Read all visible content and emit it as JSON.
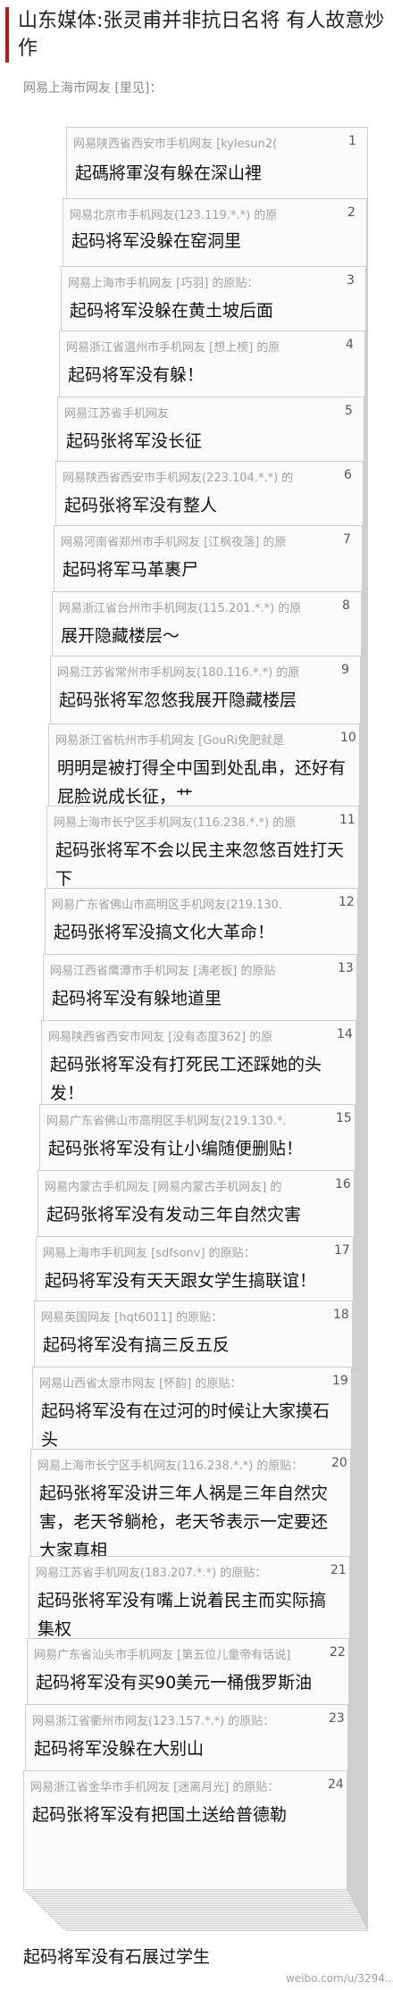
{
  "title": "山东媒体:张灵甫并非抗日名将 有人故意炒作",
  "outer_source": "网易上海市网友 [里见]：",
  "comments": [
    {
      "head": "网易陕西省西安市手机网友 [kylesun2(",
      "num": "1",
      "body": "起碼將軍沒有躲在深山裡"
    },
    {
      "head": "网易北京市手机网友(123.119.*.*) 的原",
      "num": "2",
      "body": "起码将军没躲在窑洞里"
    },
    {
      "head": "网易上海市手机网友 [巧羽] 的原贴：",
      "num": "3",
      "body": "起码将军没躲在黄土坡后面"
    },
    {
      "head": "网易浙江省温州市手机网友 [想上榜] 的原",
      "num": "4",
      "body": "起码将军没有躲！"
    },
    {
      "head": "网易江苏省手机网友",
      "num": "5",
      "body": "起码张将军没长征"
    },
    {
      "head": "网易陕西省西安市手机网友(223.104.*.*) 的",
      "num": "6",
      "body": "起码张将军没有整人"
    },
    {
      "head": "网易河南省郑州市手机网友 [江枫夜落] 的原",
      "num": "7",
      "body": "起码将军马革裹尸"
    },
    {
      "head": "网易浙江省台州市手机网友(115.201.*.*) 的原",
      "num": "8",
      "body": "展开隐藏楼层〜"
    },
    {
      "head": "网易江苏省常州市手机网友(180.116.*.*) 的原",
      "num": "9",
      "body": "起码张将军忽悠我展开隐藏楼层"
    },
    {
      "head": "网易浙江省杭州市手机网友 [GouRi免肥就是",
      "num": "10",
      "body": "明明是被打得全中国到处乱串，还好有屁脸说成长征，艹"
    },
    {
      "head": "网易上海市长宁区手机网友(116.238.*.*) 的原",
      "num": "11",
      "body": "起码张将军不会以民主来忽悠百姓打天下"
    },
    {
      "head": "网易广东省佛山市高明区手机网友(219.130.",
      "num": "12",
      "body": "起码张将军没搞文化大革命！"
    },
    {
      "head": "网易江西省鹰潭市手机网友 [涛老板] 的原贴",
      "num": "13",
      "body": "起码将军没有躲地道里"
    },
    {
      "head": "网易陕西省西安市网友 [没有态度362] 的原",
      "num": "14",
      "body": "起码张将军没有打死民工还踩她的头发！"
    },
    {
      "head": "网易广东省佛山市高明区手机网友(219.130.*.",
      "num": "15",
      "body": "起码张将军没有让小编随便删贴！"
    },
    {
      "head": "网易内蒙古手机网友 [网易内蒙古手机网友] 的",
      "num": "16",
      "body": "起码张将军没有发动三年自然灾害"
    },
    {
      "head": "网易上海市手机网友 [sdfsonv] 的原贴：",
      "num": "17",
      "body": "起码将军没有天天跟女学生搞联谊！"
    },
    {
      "head": "网易英国网友 [hqt6011] 的原贴：",
      "num": "18",
      "body": "起码将军没有搞三反五反"
    },
    {
      "head": "网易山西省太原市网友 [怀韵] 的原贴：",
      "num": "19",
      "body": "起码将军没有在过河的时候让大家摸石头"
    },
    {
      "head": "网易上海市长宁区手机网友(116.238.*.*) 的原贴：",
      "num": "20",
      "body": "起码张将军没讲三年人祸是三年自然灾害，老天爷躺枪，老天爷表示一定要还大家真相"
    },
    {
      "head": "网易江苏省手机网友(183.207.*.*) 的原贴：",
      "num": "21",
      "body": "起码张将军没有嘴上说着民主而实际搞集权"
    },
    {
      "head": "网易广东省汕头市手机网友 [第五位儿童帝有话说]",
      "num": "22",
      "body": "起码将军没有买90美元一桶俄罗斯油"
    },
    {
      "head": "网易浙江省衢州市网友(123.157.*.*) 的原贴：",
      "num": "23",
      "body": "起码将军没躲在大别山"
    },
    {
      "head": "网易浙江省金华市手机网友 [迷离月光] 的原贴：",
      "num": "24",
      "body": "起码张将军没有把国土送给普德勒"
    }
  ],
  "final_text": "起码将军没有石展过学生",
  "watermark": "weibo.com/u/3294...1"
}
